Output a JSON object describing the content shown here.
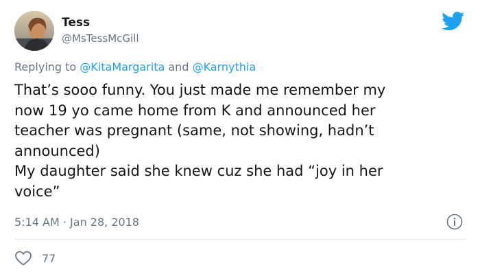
{
  "tweet": {
    "author": {
      "name": "Tess",
      "handle": "@MsTessMcGill"
    },
    "replying_to": {
      "prefix": "Replying to",
      "users": [
        "@KitaMargarita",
        "@Karnythia"
      ],
      "joiner": "and"
    },
    "lines": [
      "That’s sooo funny. You just made me remember my",
      "now 19 yo came home from K and announced her",
      "teacher was pregnant (same, not showing, hadn’t",
      "announced)",
      "My daughter said she knew cuz she had “joy in her",
      "voice”"
    ],
    "time": "5:14 AM",
    "separator": "·",
    "date": "Jan 28, 2018",
    "like_count": "77"
  },
  "icons": {
    "brand": "twitter-bird-icon",
    "info": "info-icon",
    "like": "heart-icon"
  },
  "colors": {
    "brand_blue": "#1da1f2",
    "secondary_text": "#657786",
    "primary_text": "#14171a",
    "divider": "#e1e8ed"
  }
}
